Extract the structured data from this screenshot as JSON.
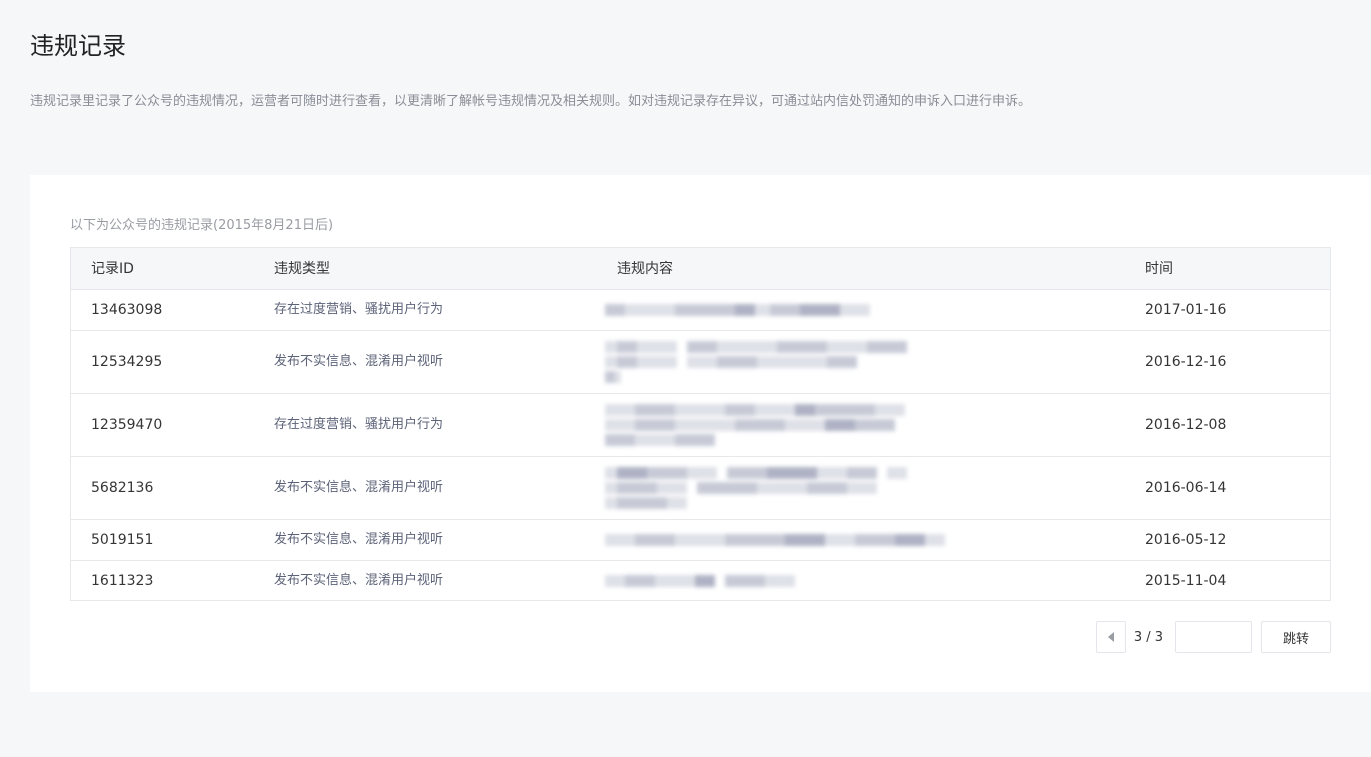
{
  "page": {
    "title": "违规记录",
    "description": "违规记录里记录了公众号的违规情况，运营者可随时进行查看，以更清晰了解帐号违规情况及相关规则。如对违规记录存在异议，可通过站内信处罚通知的申诉入口进行申诉。"
  },
  "card": {
    "caption": "以下为公众号的违规记录(2015年8月21日后)"
  },
  "table": {
    "headers": {
      "id": "记录ID",
      "type": "违规类型",
      "content": "违规内容",
      "time": "时间"
    },
    "rows": [
      {
        "id": "13463098",
        "type": "存在过度营销、骚扰用户行为",
        "time": "2017-01-16"
      },
      {
        "id": "12534295",
        "type": "发布不实信息、混淆用户视听",
        "time": "2016-12-16"
      },
      {
        "id": "12359470",
        "type": "存在过度营销、骚扰用户行为",
        "time": "2016-12-08"
      },
      {
        "id": "5682136",
        "type": "发布不实信息、混淆用户视听",
        "time": "2016-06-14"
      },
      {
        "id": "5019151",
        "type": "发布不实信息、混淆用户视听",
        "time": "2016-05-12"
      },
      {
        "id": "1611323",
        "type": "发布不实信息、混淆用户视听",
        "time": "2015-11-04"
      }
    ]
  },
  "pager": {
    "page_info": "3 / 3",
    "jump_input_value": "",
    "jump_label": "跳转"
  }
}
